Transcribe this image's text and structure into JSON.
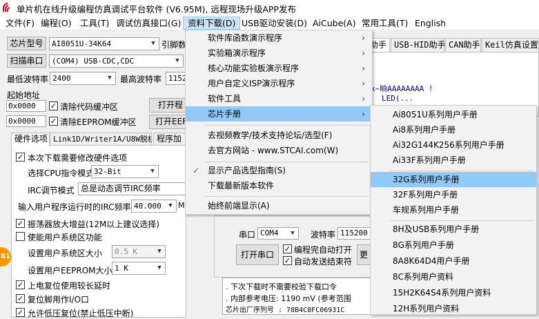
{
  "title": "单片机在线升级编程仿真调试平台软件 (V6.95M), 远程现场升级APP发布",
  "menubar": [
    "文件(F)",
    "编程(O)",
    "工具(T)",
    "调试仿真接口(G)",
    "资料下载(D)",
    "USB驱动安装(D)",
    "AiCube(A)",
    "常用工具(T)",
    "English"
  ],
  "left": {
    "chip_type_label": "芯片型号",
    "chip_type_value": "AI8051U-34K64",
    "pin_label": "引脚数",
    "scan_port_label": "扫描串口",
    "port_value": "(COM4) USB-CDC,CDC",
    "min_baud_label": "最低波特率",
    "min_baud_value": "2400",
    "max_baud_label": "最高波特率",
    "max_baud_value": "1152",
    "start_addr_label": "起始地址",
    "addr1_value": "0x0000",
    "clear_code_label": "清除代码缓冲区",
    "open_prog_label": "打开程",
    "addr2_value": "0x0000",
    "clear_eeprom_label": "清除EEPROM缓冲区",
    "open_eeprom_label": "打开EEF",
    "tabs": [
      "硬件选项",
      "Link1D/Writer1A/U8W脱机",
      "程序加"
    ]
  },
  "hw": {
    "modify_hw_label": "本次下载需要修改硬件选项",
    "cpu_mode_label": "选择CPU指令模式",
    "cpu_mode_value": "32-Bit",
    "irc_label": "IRC调节模式",
    "irc_value": "总是动态调节IRC频率",
    "freq_label": "输入用户程序运行时的IRC频率",
    "freq_value": "40.000",
    "freq_unit": "M",
    "osc_label": "振荡器放大增益(12M以上建议选择)",
    "sys_area_label": "使能用户系统区功能",
    "sys_size_label": "设置用户系统区大小",
    "sys_size_value": "0.5 K",
    "eeprom_size_label": "设置用户EEPROM大小",
    "eeprom_size_value": "1  K",
    "power_delay_label": "上电复位使用较长延时",
    "reset_pin_label": "复位脚用作I/O口",
    "lowvolt_label": "允许低压复位(禁止低压中断)",
    "badge": "81"
  },
  "right": {
    "tabs": [
      "助手",
      "USB-HID助手",
      "CAN助手",
      "Keil仿真设置"
    ],
    "code_line1": "x~晌AAAAAAAA !",
    "code_line2": "LED(...",
    "port_label": "串口",
    "port_value": "COM4",
    "baud_label": "波特率",
    "baud_value": "115200",
    "auto_open_label": "编程完自动打开",
    "auto_send_label": "自动发送结束符",
    "open_port_label": "打开串口",
    "more_label": "更",
    "log": [
      ". 下次下载时不需要校验下载口令",
      ". 内部参考电压: 1190 mV (参考范围",
      "芯片出厂序列号 : 78B4C8FC06931C"
    ]
  },
  "dropdown": {
    "items": [
      {
        "label": "软件库函数演示程序",
        "sub": "›"
      },
      {
        "label": "实验箱演示程序",
        "sub": "›"
      },
      {
        "label": "核心功能实验板演示程序",
        "sub": "›"
      },
      {
        "label": "用户自定义ISP演示程序",
        "sub": "›"
      },
      {
        "label": "软件工具",
        "sub": "›"
      },
      {
        "label": "芯片手册",
        "sub": "›"
      },
      {
        "label": "去视频教学/技术支持论坛/选型(F)"
      },
      {
        "label": "去官方网站 - www.STCAI.com(W)"
      },
      {
        "label": "显示产品选型指南(S)",
        "check": "✓"
      },
      {
        "label": "下载最新版本软件"
      },
      {
        "label": "始终前端显示(A)"
      }
    ]
  },
  "submenu": {
    "items": [
      "Ai8051U系列用户手册",
      "Ai8系列用户手册",
      "Ai32G144K256系列用户手册",
      "Ai33F系列用户手册",
      "32G系列用户手册",
      "32F系列用户手册",
      "车规系列用户手册",
      "8H及USB系列用户手册",
      "8G系列用户手册",
      "8A8K64D4用户手册",
      "8C系列用户资料",
      "15H2K64S4系列用户资料",
      "12H系列用户资料"
    ]
  },
  "colors": {
    "highlight": "#91c9f7",
    "menu_active": "#cce4f7",
    "badge": "#f39800"
  }
}
